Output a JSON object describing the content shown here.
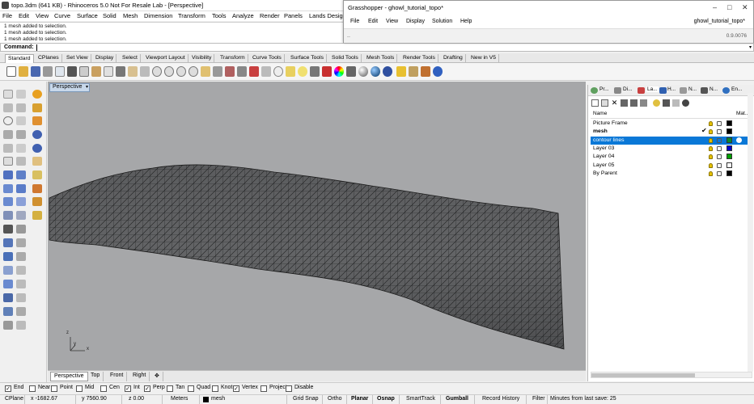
{
  "title": "topo.3dm (641 KB) - Rhinoceros 5.0 Not For Resale Lab - [Perspective]",
  "menu": [
    "File",
    "Edit",
    "View",
    "Curve",
    "Surface",
    "Solid",
    "Mesh",
    "Dimension",
    "Transform",
    "Tools",
    "Analyze",
    "Render",
    "Panels",
    "Lands Design"
  ],
  "command_history": [
    "1 mesh added to selection.",
    "1 mesh added to selection.",
    "1 mesh added to selection."
  ],
  "command_prompt": "Command:",
  "grasshopper": {
    "title": "Grasshopper - ghowl_tutorial_topo*",
    "controls": [
      "–",
      "□",
      "✕"
    ],
    "menu": [
      "File",
      "Edit",
      "View",
      "Display",
      "Solution",
      "Help"
    ],
    "document": "ghowl_tutorial_topo*",
    "strip_left": "..",
    "version": "0.9.0076"
  },
  "toolbar_tabs": [
    "Standard",
    "CPlanes",
    "Set View",
    "Display",
    "Select",
    "Viewport Layout",
    "Visibility",
    "Transform",
    "Curve Tools",
    "Surface Tools",
    "Solid Tools",
    "Mesh Tools",
    "Render Tools",
    "Drafting",
    "New in V5"
  ],
  "viewport": {
    "label": "Perspective",
    "background": "#a6a7a9",
    "axis": {
      "z": "z",
      "y": "y",
      "x": "x"
    }
  },
  "viewport_tabs": [
    "Perspective",
    "Top",
    "Front",
    "Right",
    "✥"
  ],
  "panel": {
    "tabs": [
      "Pr...",
      "Di...",
      "La...",
      "H...",
      "N...",
      "N...",
      "En..."
    ],
    "header_name": "Name",
    "header_material": "Mat...",
    "layers": [
      {
        "name": "Picture Frame",
        "color": "#000000",
        "current": false,
        "bold": false,
        "selected": false
      },
      {
        "name": "mesh",
        "color": "#000000",
        "current": true,
        "bold": true,
        "selected": false
      },
      {
        "name": "contour lines",
        "color": "#0a8a2a",
        "current": false,
        "bold": false,
        "selected": true
      },
      {
        "name": "Layer 03",
        "color": "#0000cc",
        "current": false,
        "bold": false,
        "selected": false
      },
      {
        "name": "Layer 04",
        "color": "#00a000",
        "current": false,
        "bold": false,
        "selected": false
      },
      {
        "name": "Layer 05",
        "color": "#ffffff",
        "current": false,
        "bold": false,
        "selected": false
      },
      {
        "name": "By Parent",
        "color": "#000000",
        "current": false,
        "bold": false,
        "selected": false
      }
    ],
    "current_mark": "✔"
  },
  "osnaps": [
    {
      "label": "End",
      "checked": true
    },
    {
      "label": "Near",
      "checked": false
    },
    {
      "label": "Point",
      "checked": false
    },
    {
      "label": "Mid",
      "checked": false
    },
    {
      "label": "Cen",
      "checked": false
    },
    {
      "label": "Int",
      "checked": true
    },
    {
      "label": "Perp",
      "checked": true
    },
    {
      "label": "Tan",
      "checked": false
    },
    {
      "label": "Quad",
      "checked": false
    },
    {
      "label": "Knot",
      "checked": false
    },
    {
      "label": "Vertex",
      "checked": true
    },
    {
      "label": "Project",
      "checked": false
    },
    {
      "label": "Disable",
      "checked": false
    }
  ],
  "status": {
    "cplane": "CPlane",
    "x": "x -1682.67",
    "y": "y 7560.90",
    "z": "z 0.00",
    "units": "Meters",
    "layer": "mesh",
    "grid_snap": "Grid Snap",
    "ortho": "Ortho",
    "planar": "Planar",
    "osnap": "Osnap",
    "smarttrack": "SmartTrack",
    "gumball": "Gumball",
    "record_history": "Record History",
    "filter": "Filter",
    "minutes": "Minutes from last save: 25"
  }
}
